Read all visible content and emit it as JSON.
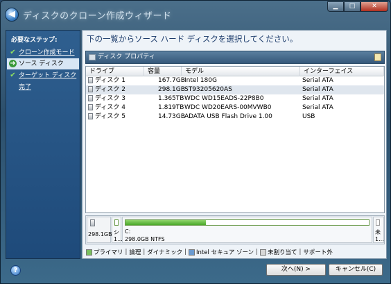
{
  "window": {
    "title": "ディスクのクローン作成ウィザード",
    "buttons": {
      "minimize": "▁",
      "maximize": "□",
      "close": "✕"
    }
  },
  "sidebar": {
    "heading": "必要なステップ:",
    "steps": [
      {
        "label": "クローン作成モード",
        "state": "done",
        "icon": "check-icon"
      },
      {
        "label": "ソース ディスク",
        "state": "active",
        "icon": "arrow-icon"
      },
      {
        "label": "ターゲット ディスク",
        "state": "done",
        "icon": "check-icon"
      },
      {
        "label": "完了",
        "state": "pending",
        "icon": ""
      }
    ]
  },
  "main": {
    "instruction": "下の一覧からソース ハード ディスクを選択してください。",
    "props_bar_label": "ディスク プロパティ"
  },
  "table": {
    "columns": [
      "ドライブ",
      "容量",
      "モデル",
      "インターフェイス"
    ],
    "rows": [
      {
        "drive": "ディスク 1",
        "capacity": "167.7GB",
        "model": "Intel 180G",
        "interface": "Serial ATA",
        "selected": false
      },
      {
        "drive": "ディスク 2",
        "capacity": "298.1GB",
        "model": "ST93205620AS",
        "interface": "Serial ATA",
        "selected": true
      },
      {
        "drive": "ディスク 3",
        "capacity": "1.365TB",
        "model": "WDC WD15EADS-22P8B0",
        "interface": "Serial ATA",
        "selected": false
      },
      {
        "drive": "ディスク 4",
        "capacity": "1.819TB",
        "model": "WDC WD20EARS-00MVWB0",
        "interface": "Serial ATA",
        "selected": false
      },
      {
        "drive": "ディスク 5",
        "capacity": "14.73GB",
        "model": "ADATA USB Flash Drive 1.00",
        "interface": "USB",
        "selected": false
      }
    ]
  },
  "diskmap": {
    "disk_size": "298.1GB",
    "partitions": [
      {
        "line1": "シ",
        "line2": "1...",
        "fill": 0.0
      },
      {
        "line1": "C:",
        "line2": "298.0GB  NTFS",
        "fill": 0.33
      },
      {
        "line1": "未",
        "line2": "1...",
        "fill": 0.0
      }
    ]
  },
  "legend": {
    "primary": "プライマリ",
    "logical": "論理",
    "dynamic": "ダイナミック",
    "intel": "Intel セキュア ゾーン",
    "unallocated": "未割り当て",
    "unsupported": "サポート外",
    "colors": {
      "primary": "#7ac060",
      "intel": "#6a9ad0",
      "unallocated": "#d8d8d8"
    }
  },
  "footer": {
    "help": "?",
    "next_label": "次へ(N) >",
    "cancel_label": "キャンセル(C)"
  }
}
